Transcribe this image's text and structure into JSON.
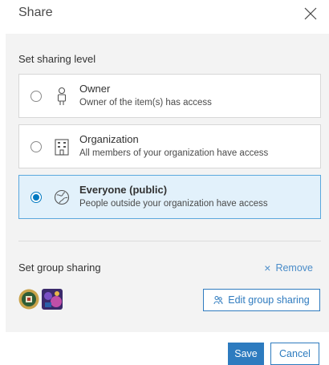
{
  "dialog": {
    "title": "Share"
  },
  "sharing_level": {
    "label": "Set sharing level",
    "options": [
      {
        "title": "Owner",
        "description": "Owner of the item(s) has access",
        "icon": "person-icon",
        "selected": false
      },
      {
        "title": "Organization",
        "description": "All members of your organization have access",
        "icon": "building-icon",
        "selected": false
      },
      {
        "title": "Everyone (public)",
        "description": "People outside your organization have access",
        "icon": "globe-icon",
        "selected": true
      }
    ]
  },
  "group_sharing": {
    "label": "Set group sharing",
    "remove_label": "Remove",
    "edit_label": "Edit group sharing",
    "groups": [
      "group-avatar-1",
      "group-avatar-2"
    ]
  },
  "footer": {
    "save_label": "Save",
    "cancel_label": "Cancel"
  },
  "colors": {
    "accent": "#0079c1",
    "selected_bg": "#e2f1fb",
    "body_bg": "#f3f3f3"
  }
}
